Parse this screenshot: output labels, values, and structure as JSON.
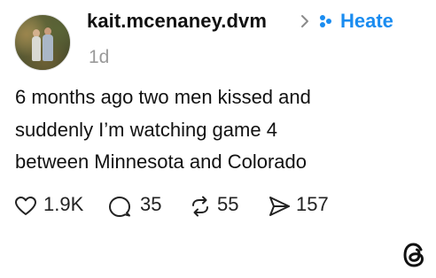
{
  "post": {
    "username": "kait.mcenaney.dvm",
    "chevron": ">",
    "topic": "Heate",
    "time": "1d",
    "body_lines": [
      "6 months ago two men kissed and",
      "suddenly I’m watching game 4",
      "between Minnesota and Colorado"
    ],
    "actions": {
      "like_count": "1.9K",
      "reply_count": "35",
      "repost_count": "55",
      "share_count": "157"
    }
  },
  "colors": {
    "topic_blue": "#1a8cf0",
    "muted_gray": "#9a9a9a",
    "text": "#111111"
  },
  "icons": [
    "avatar-photo",
    "chevron-right-icon",
    "topic-tag-icon",
    "heart-icon",
    "comment-icon",
    "repost-icon",
    "share-icon",
    "threads-logo-icon"
  ]
}
